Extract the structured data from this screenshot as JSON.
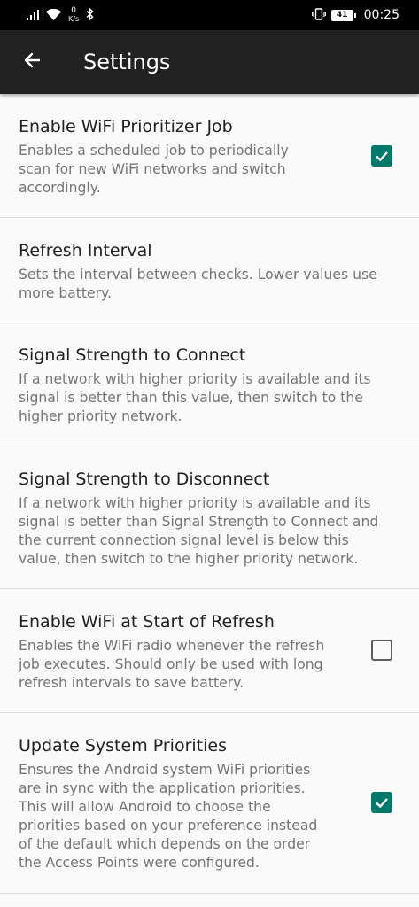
{
  "status_bar": {
    "net_speed_value": "0",
    "net_speed_unit": "K/s",
    "battery_level": "41",
    "time": "00:25"
  },
  "app_bar": {
    "title": "Settings"
  },
  "settings": [
    {
      "title": "Enable WiFi Prioritizer Job",
      "summary_lines": [
        "Enables a scheduled job to periodically",
        "scan for new WiFi networks and switch",
        "accordingly."
      ],
      "has_checkbox": true,
      "checked": true
    },
    {
      "title": "Refresh Interval",
      "summary_lines": [
        "Sets the interval between checks. Lower values use",
        "more battery."
      ],
      "has_checkbox": false
    },
    {
      "title": "Signal Strength to Connect",
      "summary_lines": [
        "If a network with higher priority is available and its",
        "signal is better than this value, then switch to the",
        "higher priority network."
      ],
      "has_checkbox": false
    },
    {
      "title": "Signal Strength to Disconnect",
      "summary_lines": [
        "If a network with higher priority is available and its",
        "signal is better than Signal Strength to Connect and",
        "the current connection signal level is below this",
        "value, then switch to the higher priority network."
      ],
      "has_checkbox": false
    },
    {
      "title": "Enable WiFi at Start of Refresh",
      "summary_lines": [
        "Enables the WiFi radio whenever the refresh",
        "job executes. Should only be used with long",
        "refresh intervals to save battery."
      ],
      "has_checkbox": true,
      "checked": false
    },
    {
      "title": "Update System Priorities",
      "summary_lines": [
        "Ensures the Android system WiFi priorities",
        "are in sync with the application priorities.",
        "This will allow Android to choose the",
        "priorities based on your preference instead",
        "of the default which depends on the order",
        "the Access Points were configured."
      ],
      "has_checkbox": true,
      "checked": true
    }
  ],
  "colors": {
    "accent": "#00796b",
    "app_bar": "#212121",
    "background": "#fafafa"
  }
}
